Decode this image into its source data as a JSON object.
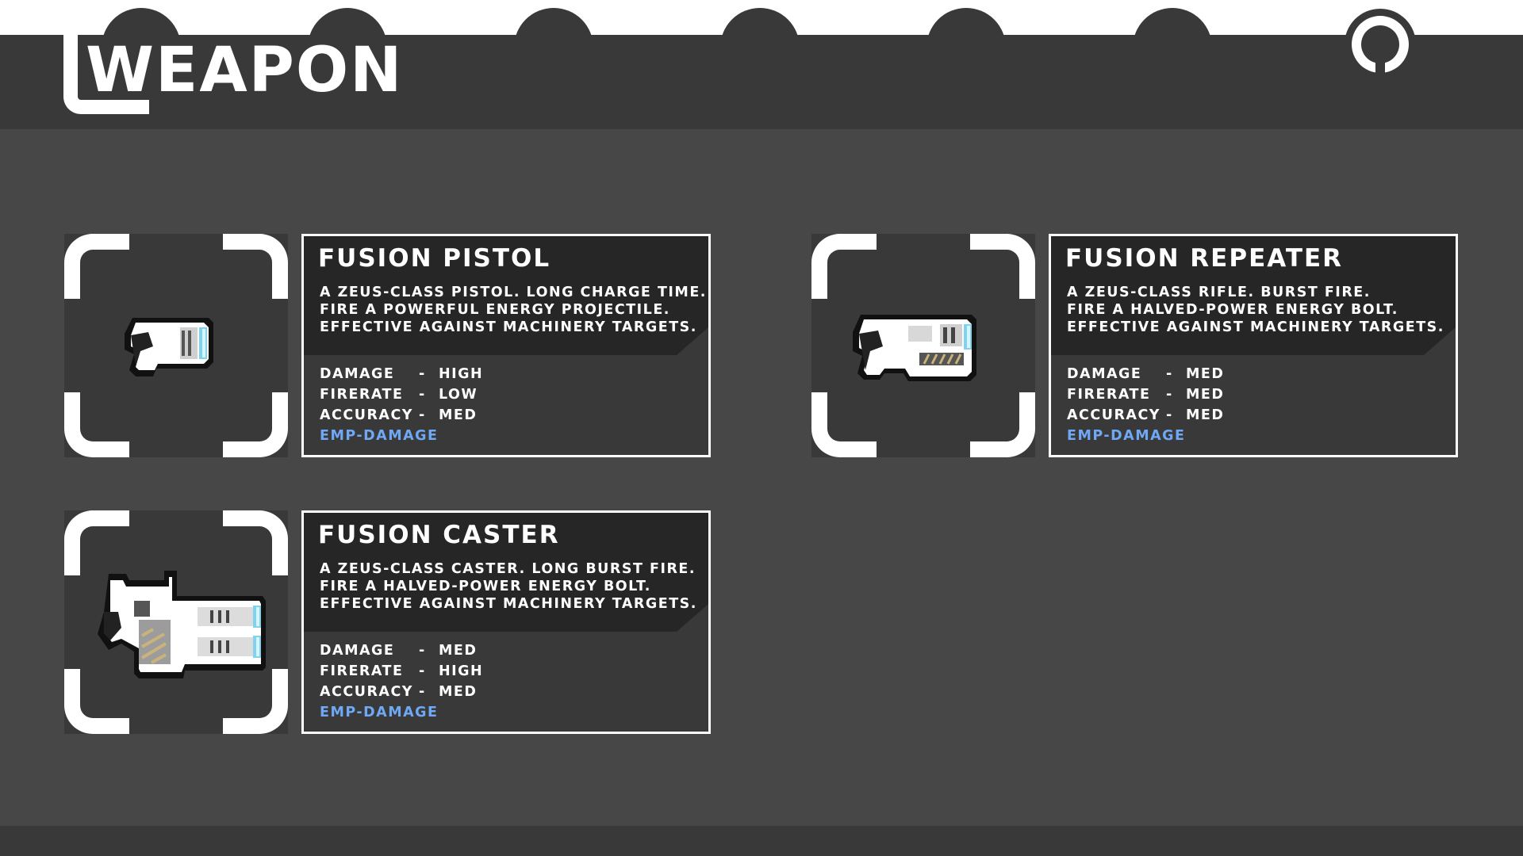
{
  "header": {
    "title": "WEAPON",
    "tab_count": 6
  },
  "colors": {
    "background": "#474747",
    "panel": "#393939",
    "panel_dark": "#262626",
    "border": "#ffffff",
    "emp_tag": "#6fa8f5",
    "energy_glow": "#7fd3f0"
  },
  "weapons": [
    {
      "name": "FUSION PISTOL",
      "icon": "fusion-pistol-icon",
      "description": [
        "A ZEUS-CLASS PISTOL. LONG CHARGE TIME.",
        "FIRE A POWERFUL ENERGY PROJECTILE.",
        "EFFECTIVE AGAINST MACHINERY TARGETS."
      ],
      "stats": [
        {
          "label": "DAMAGE",
          "dash": "-",
          "value": "HIGH"
        },
        {
          "label": "FIRERATE",
          "dash": "-",
          "value": "LOW"
        },
        {
          "label": "ACCURACY",
          "dash": "-",
          "value": "MED"
        }
      ],
      "tag": "EMP-DAMAGE"
    },
    {
      "name": "FUSION REPEATER",
      "icon": "fusion-repeater-icon",
      "description": [
        "A ZEUS-CLASS RIFLE. BURST FIRE.",
        "FIRE A HALVED-POWER ENERGY BOLT.",
        "EFFECTIVE AGAINST MACHINERY TARGETS."
      ],
      "stats": [
        {
          "label": "DAMAGE",
          "dash": "-",
          "value": "MED"
        },
        {
          "label": "FIRERATE",
          "dash": "-",
          "value": "MED"
        },
        {
          "label": "ACCURACY",
          "dash": "-",
          "value": "MED"
        }
      ],
      "tag": "EMP-DAMAGE"
    },
    {
      "name": "FUSION CASTER",
      "icon": "fusion-caster-icon",
      "description": [
        "A ZEUS-CLASS CASTER. LONG BURST FIRE.",
        "FIRE A HALVED-POWER ENERGY BOLT.",
        "EFFECTIVE AGAINST MACHINERY TARGETS."
      ],
      "stats": [
        {
          "label": "DAMAGE",
          "dash": "-",
          "value": "MED"
        },
        {
          "label": "FIRERATE",
          "dash": "-",
          "value": "HIGH"
        },
        {
          "label": "ACCURACY",
          "dash": "-",
          "value": "MED"
        }
      ],
      "tag": "EMP-DAMAGE"
    }
  ]
}
